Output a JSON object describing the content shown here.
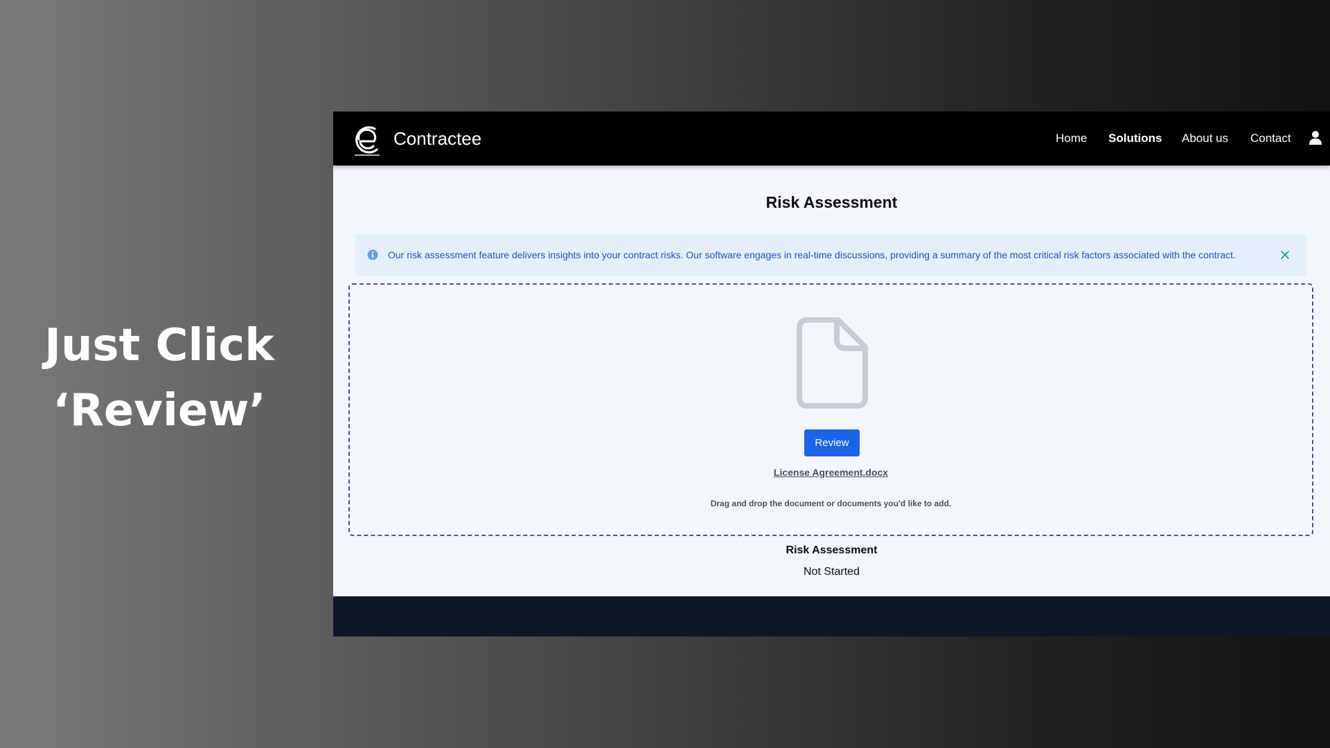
{
  "caption": {
    "line1": "Just Click",
    "line2": "‘Review’"
  },
  "navbar": {
    "brand": "Contractee",
    "links": [
      {
        "label": "Home"
      },
      {
        "label": "Solutions",
        "active": true
      },
      {
        "label": "About us"
      },
      {
        "label": "Contact"
      }
    ],
    "user_icon": "user-icon",
    "logo_icon": "contractee-logo"
  },
  "page": {
    "title": "Risk Assessment"
  },
  "alert": {
    "icon": "info-icon",
    "text": "Our risk assessment feature delivers insights into your contract risks. Our software engages in real-time discussions, providing a summary of the most critical risk factors associated with the contract.",
    "close_icon": "close-icon"
  },
  "dropzone": {
    "icon": "document-icon",
    "review_label": "Review",
    "file_name": "License Agreement.docx",
    "hint": "Drag and drop the document or documents you'd like to add."
  },
  "status": {
    "label": "Risk Assessment",
    "value": "Not Started"
  },
  "colors": {
    "navbar": "#000000",
    "accent": "#1a64e8",
    "alert_bg": "#e5effa",
    "alert_text": "#1f53b8",
    "page_bg": "#f3f7fc",
    "footer": "#0f1626"
  }
}
